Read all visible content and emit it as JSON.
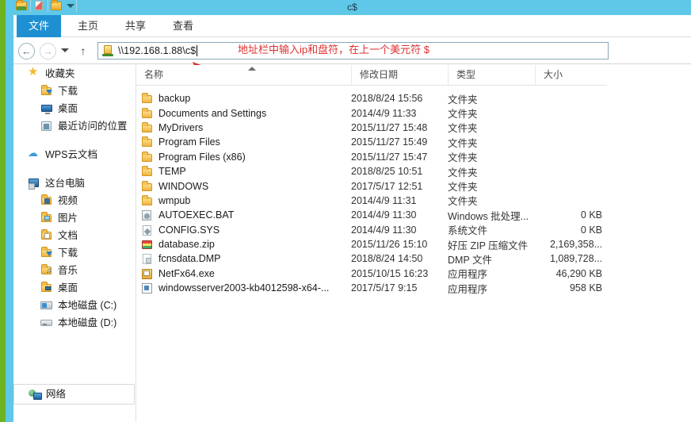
{
  "window": {
    "title": "c$"
  },
  "quick_access": {
    "icons": [
      "folder-icon",
      "brush-icon",
      "folder-properties-icon",
      "customize-caret-icon"
    ]
  },
  "ribbon": {
    "tabs": [
      {
        "label": "文件",
        "selected": true
      },
      {
        "label": "主页",
        "selected": false
      },
      {
        "label": "共享",
        "selected": false
      },
      {
        "label": "查看",
        "selected": false
      }
    ]
  },
  "navbar": {
    "back_icon": "◄",
    "forward_icon": "►",
    "recent_caret_icon": "chevron-down-icon",
    "up_icon": "↑",
    "address_value": "\\\\192.168.1.88\\c$",
    "address_icon": "network-server-icon"
  },
  "annotation": {
    "text": "地址栏中输入ip和盘符，在上一个美元符 $",
    "color": "#e03131",
    "arrow": "red-arrow-pointing-to-address-bar"
  },
  "sidebar": {
    "groups": [
      {
        "name": "favorites",
        "items": [
          {
            "label": "收藏夹",
            "icon": "star-icon",
            "level": 0
          },
          {
            "label": "下载",
            "icon": "folder-download-icon",
            "level": 1
          },
          {
            "label": "桌面",
            "icon": "desktop-monitor-icon",
            "level": 1
          },
          {
            "label": "最近访问的位置",
            "icon": "recent-places-icon",
            "level": 1
          }
        ]
      },
      {
        "name": "wps-cloud",
        "items": [
          {
            "label": "WPS云文档",
            "icon": "cloud-icon",
            "level": 0
          }
        ]
      },
      {
        "name": "this-pc",
        "items": [
          {
            "label": "这台电脑",
            "icon": "computer-icon",
            "level": 0
          },
          {
            "label": "视频",
            "icon": "folder-video-icon",
            "level": 1
          },
          {
            "label": "图片",
            "icon": "folder-pictures-icon",
            "level": 1
          },
          {
            "label": "文档",
            "icon": "folder-documents-icon",
            "level": 1
          },
          {
            "label": "下载",
            "icon": "folder-download-icon",
            "level": 1
          },
          {
            "label": "音乐",
            "icon": "folder-music-icon",
            "level": 1
          },
          {
            "label": "桌面",
            "icon": "folder-desktop-icon",
            "level": 1
          },
          {
            "label": "本地磁盘 (C:)",
            "icon": "drive-system-icon",
            "level": 1
          },
          {
            "label": "本地磁盘 (D:)",
            "icon": "drive-icon",
            "level": 1
          }
        ]
      }
    ],
    "network": {
      "label": "网络",
      "icon": "network-icon"
    }
  },
  "filelist": {
    "columns": [
      {
        "key": "name",
        "label": "名称",
        "sorted": "asc"
      },
      {
        "key": "date",
        "label": "修改日期"
      },
      {
        "key": "type",
        "label": "类型"
      },
      {
        "key": "size",
        "label": "大小"
      }
    ],
    "rows": [
      {
        "name": "backup",
        "date": "2018/8/24 15:56",
        "type": "文件夹",
        "size": "",
        "icon": "folder-icon"
      },
      {
        "name": "Documents and Settings",
        "date": "2014/4/9 11:33",
        "type": "文件夹",
        "size": "",
        "icon": "folder-icon"
      },
      {
        "name": "MyDrivers",
        "date": "2015/11/27 15:48",
        "type": "文件夹",
        "size": "",
        "icon": "folder-icon"
      },
      {
        "name": "Program Files",
        "date": "2015/11/27 15:49",
        "type": "文件夹",
        "size": "",
        "icon": "folder-icon"
      },
      {
        "name": "Program Files (x86)",
        "date": "2015/11/27 15:47",
        "type": "文件夹",
        "size": "",
        "icon": "folder-icon"
      },
      {
        "name": "TEMP",
        "date": "2018/8/25 10:51",
        "type": "文件夹",
        "size": "",
        "icon": "folder-icon"
      },
      {
        "name": "WINDOWS",
        "date": "2017/5/17 12:51",
        "type": "文件夹",
        "size": "",
        "icon": "folder-icon"
      },
      {
        "name": "wmpub",
        "date": "2014/4/9 11:31",
        "type": "文件夹",
        "size": "",
        "icon": "folder-icon"
      },
      {
        "name": "AUTOEXEC.BAT",
        "date": "2014/4/9 11:30",
        "type": "Windows 批处理...",
        "size": "0 KB",
        "icon": "bat-file-icon"
      },
      {
        "name": "CONFIG.SYS",
        "date": "2014/4/9 11:30",
        "type": "系统文件",
        "size": "0 KB",
        "icon": "sys-file-icon"
      },
      {
        "name": "database.zip",
        "date": "2015/11/26 15:10",
        "type": "好压 ZIP 压缩文件",
        "size": "2,169,358...",
        "icon": "zip-file-icon"
      },
      {
        "name": "fcnsdata.DMP",
        "date": "2018/8/24 14:50",
        "type": "DMP 文件",
        "size": "1,089,728...",
        "icon": "dmp-file-icon"
      },
      {
        "name": "NetFx64.exe",
        "date": "2015/10/15 16:23",
        "type": "应用程序",
        "size": "46,290 KB",
        "icon": "exe-file-icon"
      },
      {
        "name": "windowsserver2003-kb4012598-x64-...",
        "date": "2017/5/17 9:15",
        "type": "应用程序",
        "size": "958 KB",
        "icon": "app-file-icon"
      }
    ]
  }
}
